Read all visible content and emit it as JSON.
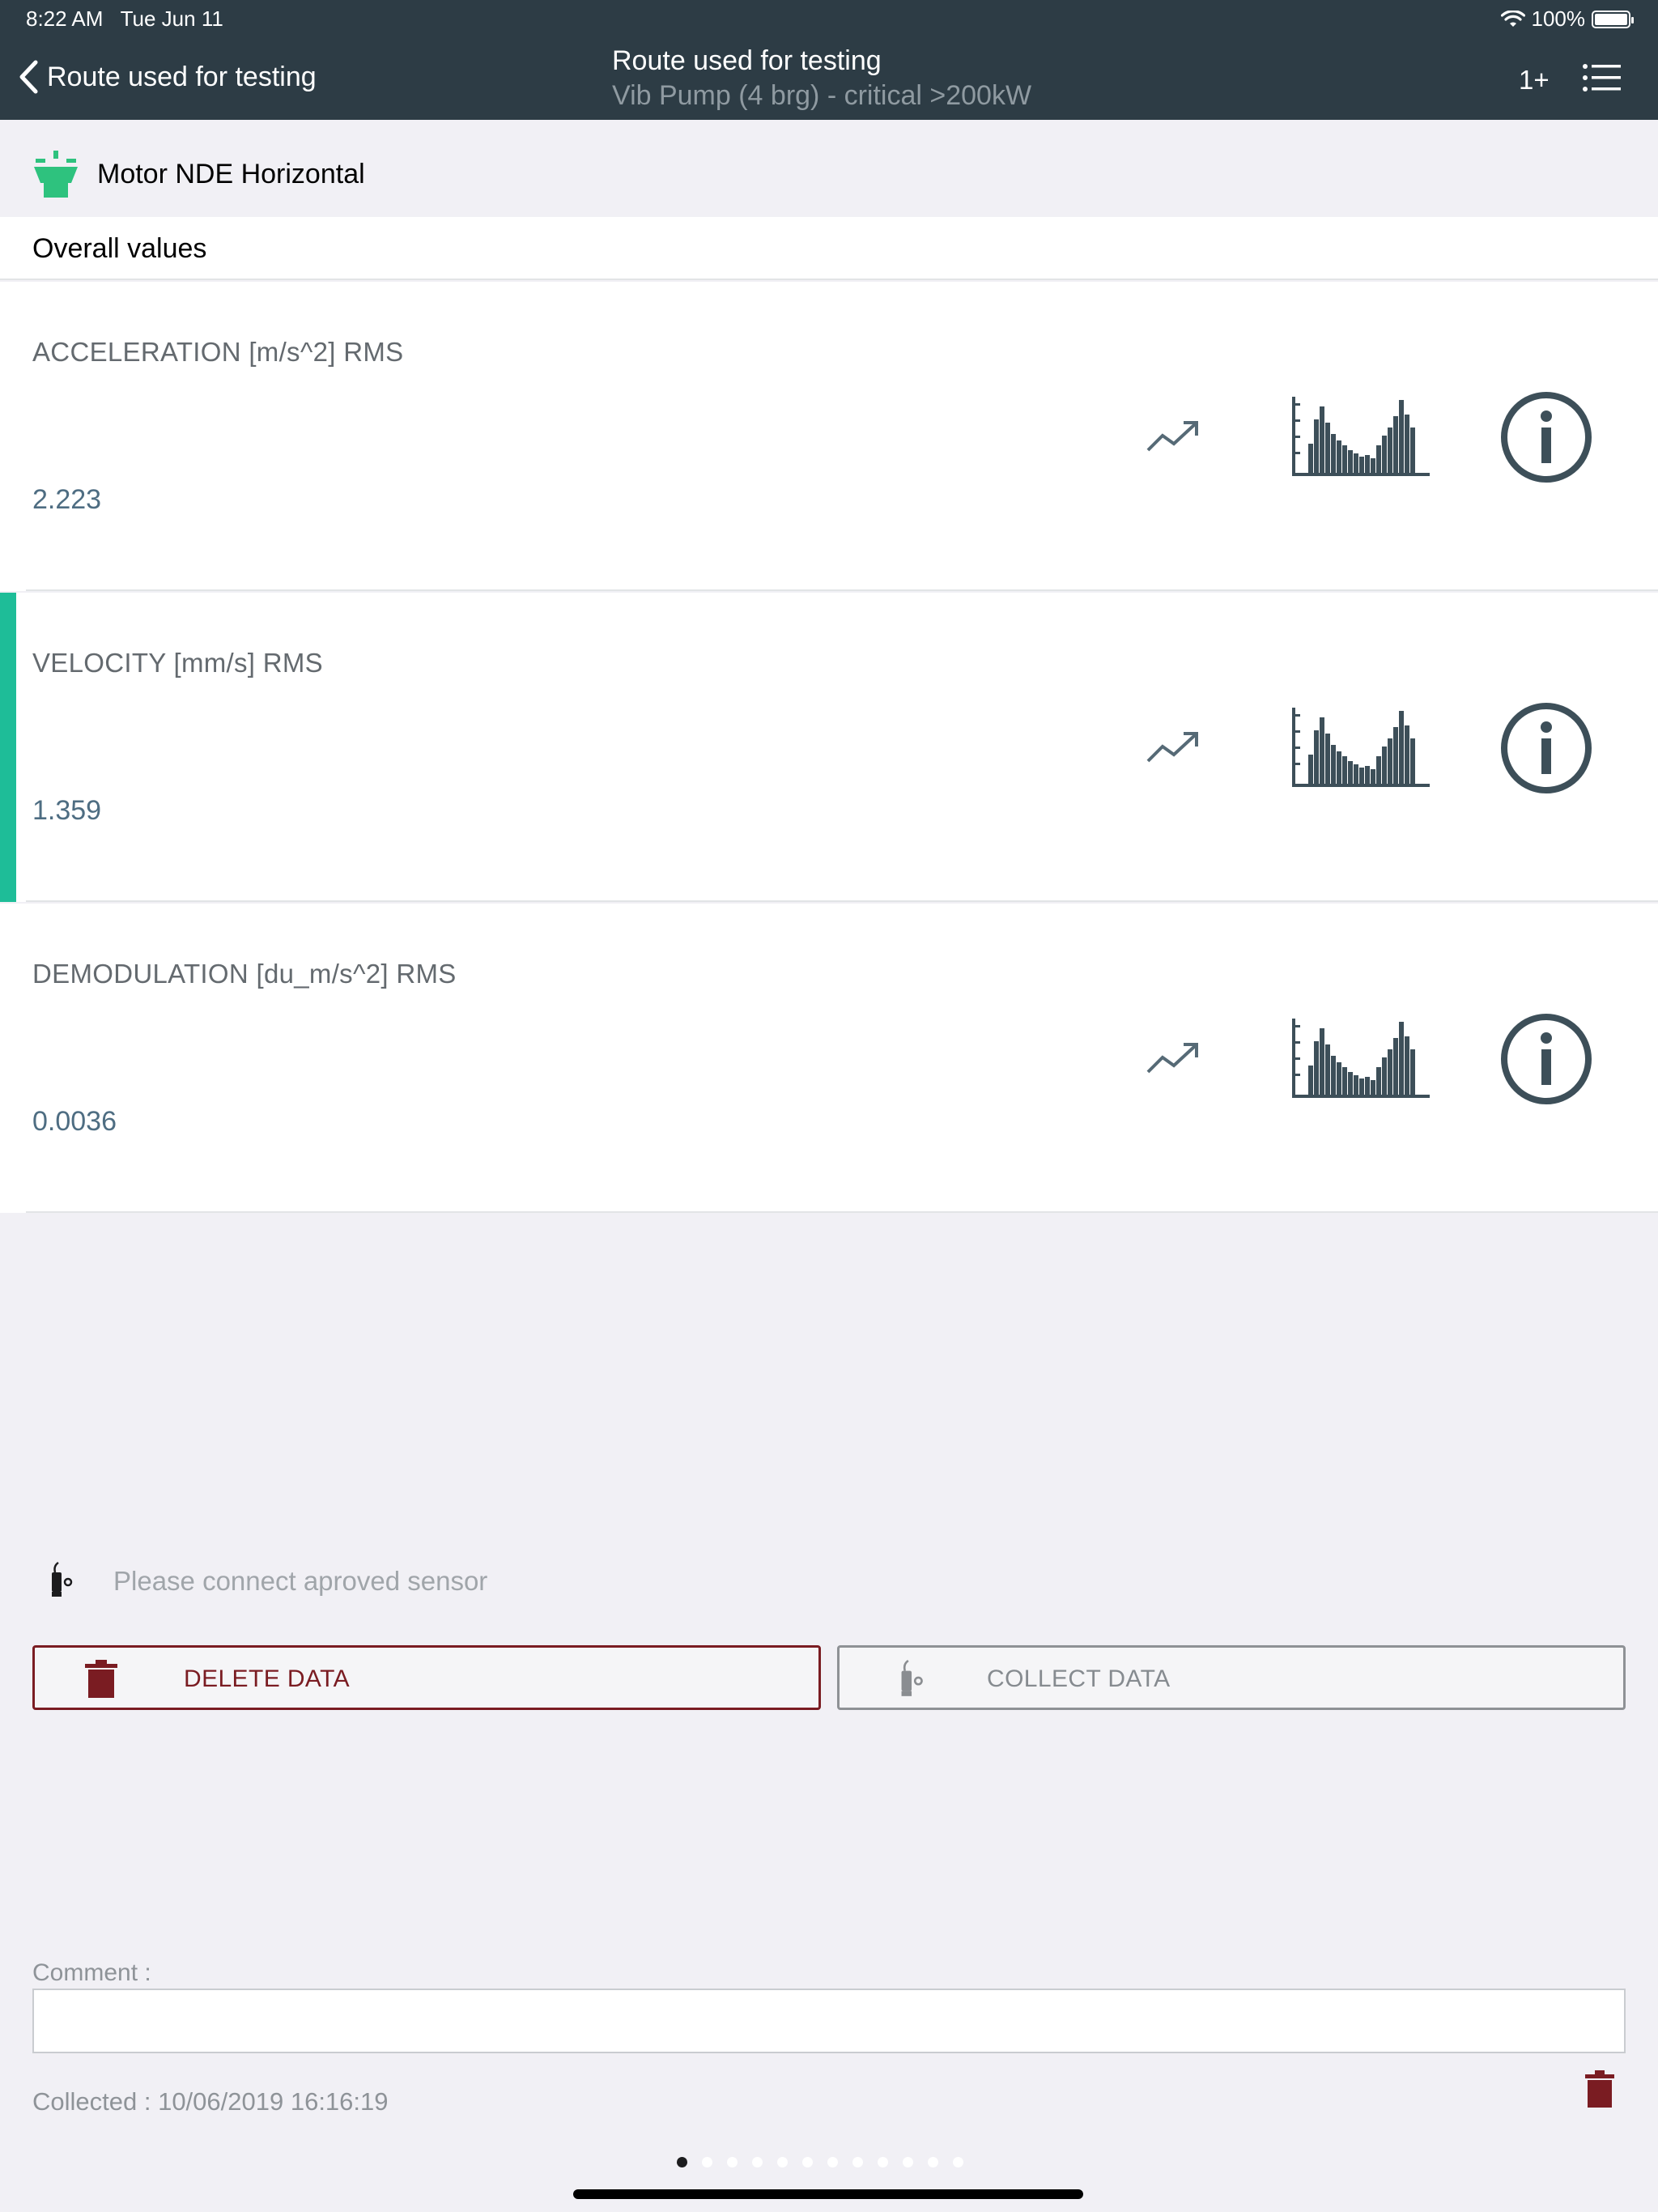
{
  "status_bar": {
    "time": "8:22 AM",
    "date": "Tue Jun 11",
    "battery": "100%"
  },
  "nav": {
    "back_label": "Route used for testing",
    "title": "Route used for testing",
    "subtitle": "Vib Pump (4 brg) - critical >200kW",
    "count": "1+"
  },
  "point": {
    "title": "Motor NDE Horizontal"
  },
  "section": {
    "title": "Overall values"
  },
  "measurements": [
    {
      "label": "ACCELERATION [m/s^2] RMS",
      "value": "2.223",
      "selected": false
    },
    {
      "label": "VELOCITY [mm/s] RMS",
      "value": "1.359",
      "selected": true
    },
    {
      "label": "DEMODULATION [du_m/s^2] RMS",
      "value": "0.0036",
      "selected": false
    }
  ],
  "sensor": {
    "message": "Please connect aproved sensor"
  },
  "buttons": {
    "delete_label": "DELETE DATA",
    "collect_label": "COLLECT DATA"
  },
  "comment": {
    "label": "Comment :",
    "value": ""
  },
  "collected": {
    "text": "Collected : 10/06/2019 16:16:19"
  },
  "pagination": {
    "current": 1,
    "total": 12
  },
  "colors": {
    "header_bg": "#2d3c45",
    "accent_green": "#1ebd98",
    "danger": "#7a1c22",
    "value_text": "#4e6d82",
    "icon_dark": "#3d4f59"
  }
}
